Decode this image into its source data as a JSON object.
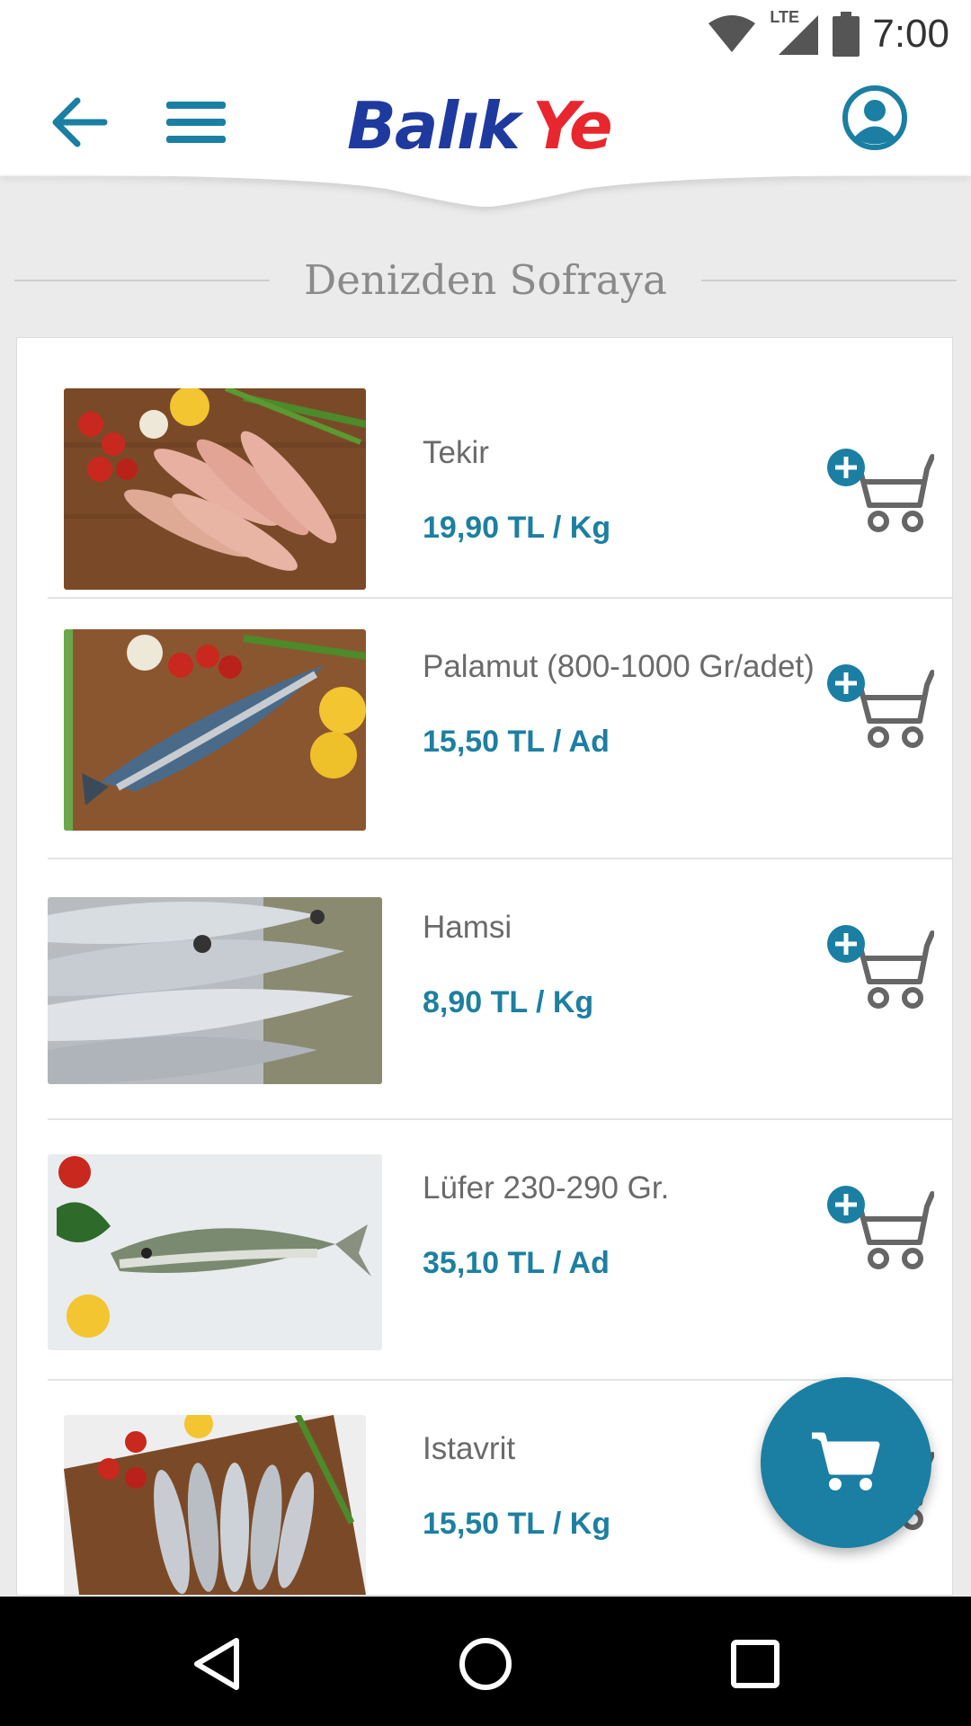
{
  "status_bar": {
    "time": "7:00",
    "network_label": "LTE",
    "icons": [
      "wifi-icon",
      "lte-signal-icon",
      "battery-icon"
    ]
  },
  "app_bar": {
    "logo_text_part1": "Balık",
    "logo_text_part2": "Ye",
    "icons": [
      "back-arrow-icon",
      "hamburger-menu-icon",
      "user-profile-icon"
    ]
  },
  "section": {
    "title": "Denizden Sofraya"
  },
  "products": [
    {
      "name": "Tekir",
      "price": "19,90 TL / Kg",
      "image": "red-mullet-photo"
    },
    {
      "name": "Palamut (800-1000 Gr/adet)",
      "price": "15,50 TL / Ad",
      "image": "bonito-photo"
    },
    {
      "name": "Hamsi",
      "price": "8,90 TL / Kg",
      "image": "anchovy-photo"
    },
    {
      "name": "Lüfer 230-290 Gr.",
      "price": "35,10 TL / Ad",
      "image": "bluefish-photo"
    },
    {
      "name": "Istavrit",
      "price": "15,50 TL / Kg",
      "image": "horse-mackerel-photo"
    }
  ],
  "colors": {
    "accent": "#1a7fa2",
    "price": "#1d7fa1",
    "logo_blue": "#1f3a9e",
    "logo_red": "#e8262e",
    "background": "#ebebeb"
  }
}
